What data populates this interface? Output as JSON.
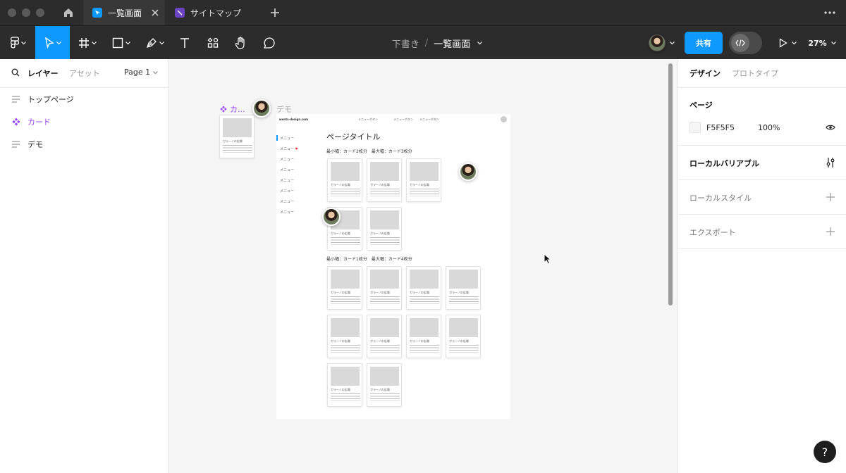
{
  "tabs": [
    {
      "label": "一覧画面",
      "active": true,
      "icon": "figma-file-icon"
    },
    {
      "label": "サイトマップ",
      "active": false,
      "icon": "figjam-file-icon"
    }
  ],
  "toolbar": {
    "breadcrumb_project": "下書き",
    "breadcrumb_sep": "/",
    "breadcrumb_file": "一覧画面",
    "share_label": "共有",
    "zoom": "27%",
    "accent": "#0d99ff"
  },
  "layers_panel": {
    "tab_layers": "レイヤー",
    "tab_assets": "アセット",
    "page_select": "Page 1",
    "items": [
      {
        "label": "トップページ",
        "icon": "frame-lines-icon"
      },
      {
        "label": "カード",
        "icon": "component-icon",
        "color": "#9747ff"
      },
      {
        "label": "デモ",
        "icon": "frame-lines-icon"
      }
    ]
  },
  "canvas": {
    "component_label": "カ...",
    "demo_label": "デモ",
    "component_color": "#9747ff",
    "site_logo": "wents-design.com",
    "nav_links": [
      "メニューボタン",
      "メニューボタン",
      "メニューボタン"
    ],
    "side_menu": [
      "メニュー",
      "メニュー",
      "メニュー",
      "メニュー",
      "メニュー",
      "メニュー",
      "メニュー",
      "メニュー"
    ],
    "page_title": "ページタイトル",
    "section1_caption": "最小幅：カード2枚分　最大幅：カード3枚分",
    "section2_caption": "最小幅：カード1枚分　最大幅：カード4枚分",
    "card_title": "ガラーノの広場",
    "card_count_section1": 5,
    "card_count_section2": 10
  },
  "design_panel": {
    "tab_design": "デザイン",
    "tab_prototype": "プロトタイプ",
    "page_heading": "ページ",
    "bg_color_hex": "F5F5F5",
    "bg_opacity": "100%",
    "local_variables": "ローカルバリアブル",
    "local_styles": "ローカルスタイル",
    "export": "エクスポート"
  },
  "help": "?"
}
